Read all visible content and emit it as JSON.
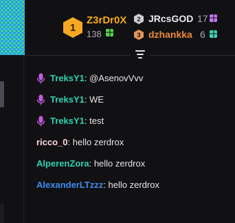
{
  "leaderboard": {
    "first": {
      "rank": "1",
      "name": "Z3rDr0X",
      "score": "138",
      "gift_icon": "gift-icon",
      "rank_color": "#f7a823"
    },
    "second": {
      "rank": "2",
      "name": "JRcsGOD",
      "score": "17",
      "gift_icon": "gift-icon"
    },
    "third": {
      "rank": "3",
      "name": "dzhankka",
      "score": "6",
      "gift_icon": "gift-icon"
    }
  },
  "chat": {
    "messages": [
      {
        "user": "TreksY1",
        "separator": ":",
        "text": " @AsenovVvv",
        "voice": true,
        "color": "#2fd2b4"
      },
      {
        "user": "TreksY1",
        "separator": ":",
        "text": " WE",
        "voice": true,
        "color": "#2fd2b4"
      },
      {
        "user": "TreksY1",
        "separator": ":",
        "text": " test",
        "voice": true,
        "color": "#2fd2b4"
      },
      {
        "user": "ricco_0",
        "separator": ":",
        "text": " hello zerdrox",
        "voice": false,
        "color": "#ffd9dd"
      },
      {
        "user": "AlperenZora",
        "separator": ":",
        "text": " hello zerdrox",
        "voice": false,
        "color": "#2fd2b4"
      },
      {
        "user": "AlexanderLTzzz",
        "separator": ":",
        "text": " hello zerdrox",
        "voice": false,
        "color": "#3c8cf2"
      }
    ]
  },
  "icons": {
    "microphone": "microphone-icon",
    "collapse": "collapse-icon"
  },
  "colors": {
    "mic": "#c45be0",
    "background": "#111113"
  }
}
